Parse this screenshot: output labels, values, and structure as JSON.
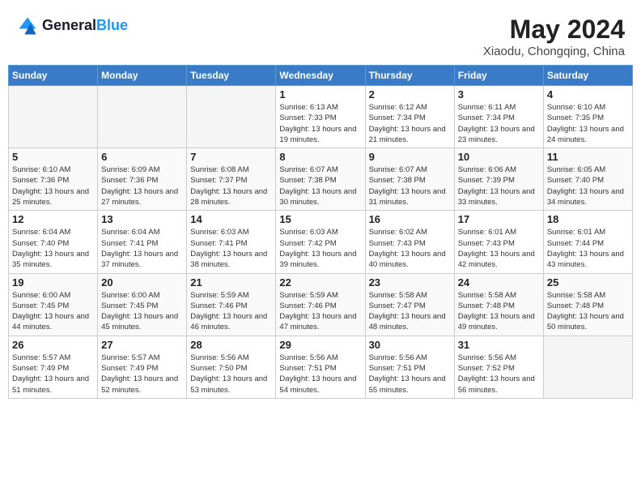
{
  "header": {
    "logo_general": "General",
    "logo_blue": "Blue",
    "month_year": "May 2024",
    "location": "Xiaodu, Chongqing, China"
  },
  "weekdays": [
    "Sunday",
    "Monday",
    "Tuesday",
    "Wednesday",
    "Thursday",
    "Friday",
    "Saturday"
  ],
  "weeks": [
    [
      {
        "day": "",
        "sunrise": "",
        "sunset": "",
        "daylight": ""
      },
      {
        "day": "",
        "sunrise": "",
        "sunset": "",
        "daylight": ""
      },
      {
        "day": "",
        "sunrise": "",
        "sunset": "",
        "daylight": ""
      },
      {
        "day": "1",
        "sunrise": "Sunrise: 6:13 AM",
        "sunset": "Sunset: 7:33 PM",
        "daylight": "Daylight: 13 hours and 19 minutes."
      },
      {
        "day": "2",
        "sunrise": "Sunrise: 6:12 AM",
        "sunset": "Sunset: 7:34 PM",
        "daylight": "Daylight: 13 hours and 21 minutes."
      },
      {
        "day": "3",
        "sunrise": "Sunrise: 6:11 AM",
        "sunset": "Sunset: 7:34 PM",
        "daylight": "Daylight: 13 hours and 23 minutes."
      },
      {
        "day": "4",
        "sunrise": "Sunrise: 6:10 AM",
        "sunset": "Sunset: 7:35 PM",
        "daylight": "Daylight: 13 hours and 24 minutes."
      }
    ],
    [
      {
        "day": "5",
        "sunrise": "Sunrise: 6:10 AM",
        "sunset": "Sunset: 7:36 PM",
        "daylight": "Daylight: 13 hours and 25 minutes."
      },
      {
        "day": "6",
        "sunrise": "Sunrise: 6:09 AM",
        "sunset": "Sunset: 7:36 PM",
        "daylight": "Daylight: 13 hours and 27 minutes."
      },
      {
        "day": "7",
        "sunrise": "Sunrise: 6:08 AM",
        "sunset": "Sunset: 7:37 PM",
        "daylight": "Daylight: 13 hours and 28 minutes."
      },
      {
        "day": "8",
        "sunrise": "Sunrise: 6:07 AM",
        "sunset": "Sunset: 7:38 PM",
        "daylight": "Daylight: 13 hours and 30 minutes."
      },
      {
        "day": "9",
        "sunrise": "Sunrise: 6:07 AM",
        "sunset": "Sunset: 7:38 PM",
        "daylight": "Daylight: 13 hours and 31 minutes."
      },
      {
        "day": "10",
        "sunrise": "Sunrise: 6:06 AM",
        "sunset": "Sunset: 7:39 PM",
        "daylight": "Daylight: 13 hours and 33 minutes."
      },
      {
        "day": "11",
        "sunrise": "Sunrise: 6:05 AM",
        "sunset": "Sunset: 7:40 PM",
        "daylight": "Daylight: 13 hours and 34 minutes."
      }
    ],
    [
      {
        "day": "12",
        "sunrise": "Sunrise: 6:04 AM",
        "sunset": "Sunset: 7:40 PM",
        "daylight": "Daylight: 13 hours and 35 minutes."
      },
      {
        "day": "13",
        "sunrise": "Sunrise: 6:04 AM",
        "sunset": "Sunset: 7:41 PM",
        "daylight": "Daylight: 13 hours and 37 minutes."
      },
      {
        "day": "14",
        "sunrise": "Sunrise: 6:03 AM",
        "sunset": "Sunset: 7:41 PM",
        "daylight": "Daylight: 13 hours and 38 minutes."
      },
      {
        "day": "15",
        "sunrise": "Sunrise: 6:03 AM",
        "sunset": "Sunset: 7:42 PM",
        "daylight": "Daylight: 13 hours and 39 minutes."
      },
      {
        "day": "16",
        "sunrise": "Sunrise: 6:02 AM",
        "sunset": "Sunset: 7:43 PM",
        "daylight": "Daylight: 13 hours and 40 minutes."
      },
      {
        "day": "17",
        "sunrise": "Sunrise: 6:01 AM",
        "sunset": "Sunset: 7:43 PM",
        "daylight": "Daylight: 13 hours and 42 minutes."
      },
      {
        "day": "18",
        "sunrise": "Sunrise: 6:01 AM",
        "sunset": "Sunset: 7:44 PM",
        "daylight": "Daylight: 13 hours and 43 minutes."
      }
    ],
    [
      {
        "day": "19",
        "sunrise": "Sunrise: 6:00 AM",
        "sunset": "Sunset: 7:45 PM",
        "daylight": "Daylight: 13 hours and 44 minutes."
      },
      {
        "day": "20",
        "sunrise": "Sunrise: 6:00 AM",
        "sunset": "Sunset: 7:45 PM",
        "daylight": "Daylight: 13 hours and 45 minutes."
      },
      {
        "day": "21",
        "sunrise": "Sunrise: 5:59 AM",
        "sunset": "Sunset: 7:46 PM",
        "daylight": "Daylight: 13 hours and 46 minutes."
      },
      {
        "day": "22",
        "sunrise": "Sunrise: 5:59 AM",
        "sunset": "Sunset: 7:46 PM",
        "daylight": "Daylight: 13 hours and 47 minutes."
      },
      {
        "day": "23",
        "sunrise": "Sunrise: 5:58 AM",
        "sunset": "Sunset: 7:47 PM",
        "daylight": "Daylight: 13 hours and 48 minutes."
      },
      {
        "day": "24",
        "sunrise": "Sunrise: 5:58 AM",
        "sunset": "Sunset: 7:48 PM",
        "daylight": "Daylight: 13 hours and 49 minutes."
      },
      {
        "day": "25",
        "sunrise": "Sunrise: 5:58 AM",
        "sunset": "Sunset: 7:48 PM",
        "daylight": "Daylight: 13 hours and 50 minutes."
      }
    ],
    [
      {
        "day": "26",
        "sunrise": "Sunrise: 5:57 AM",
        "sunset": "Sunset: 7:49 PM",
        "daylight": "Daylight: 13 hours and 51 minutes."
      },
      {
        "day": "27",
        "sunrise": "Sunrise: 5:57 AM",
        "sunset": "Sunset: 7:49 PM",
        "daylight": "Daylight: 13 hours and 52 minutes."
      },
      {
        "day": "28",
        "sunrise": "Sunrise: 5:56 AM",
        "sunset": "Sunset: 7:50 PM",
        "daylight": "Daylight: 13 hours and 53 minutes."
      },
      {
        "day": "29",
        "sunrise": "Sunrise: 5:56 AM",
        "sunset": "Sunset: 7:51 PM",
        "daylight": "Daylight: 13 hours and 54 minutes."
      },
      {
        "day": "30",
        "sunrise": "Sunrise: 5:56 AM",
        "sunset": "Sunset: 7:51 PM",
        "daylight": "Daylight: 13 hours and 55 minutes."
      },
      {
        "day": "31",
        "sunrise": "Sunrise: 5:56 AM",
        "sunset": "Sunset: 7:52 PM",
        "daylight": "Daylight: 13 hours and 56 minutes."
      },
      {
        "day": "",
        "sunrise": "",
        "sunset": "",
        "daylight": ""
      }
    ]
  ]
}
